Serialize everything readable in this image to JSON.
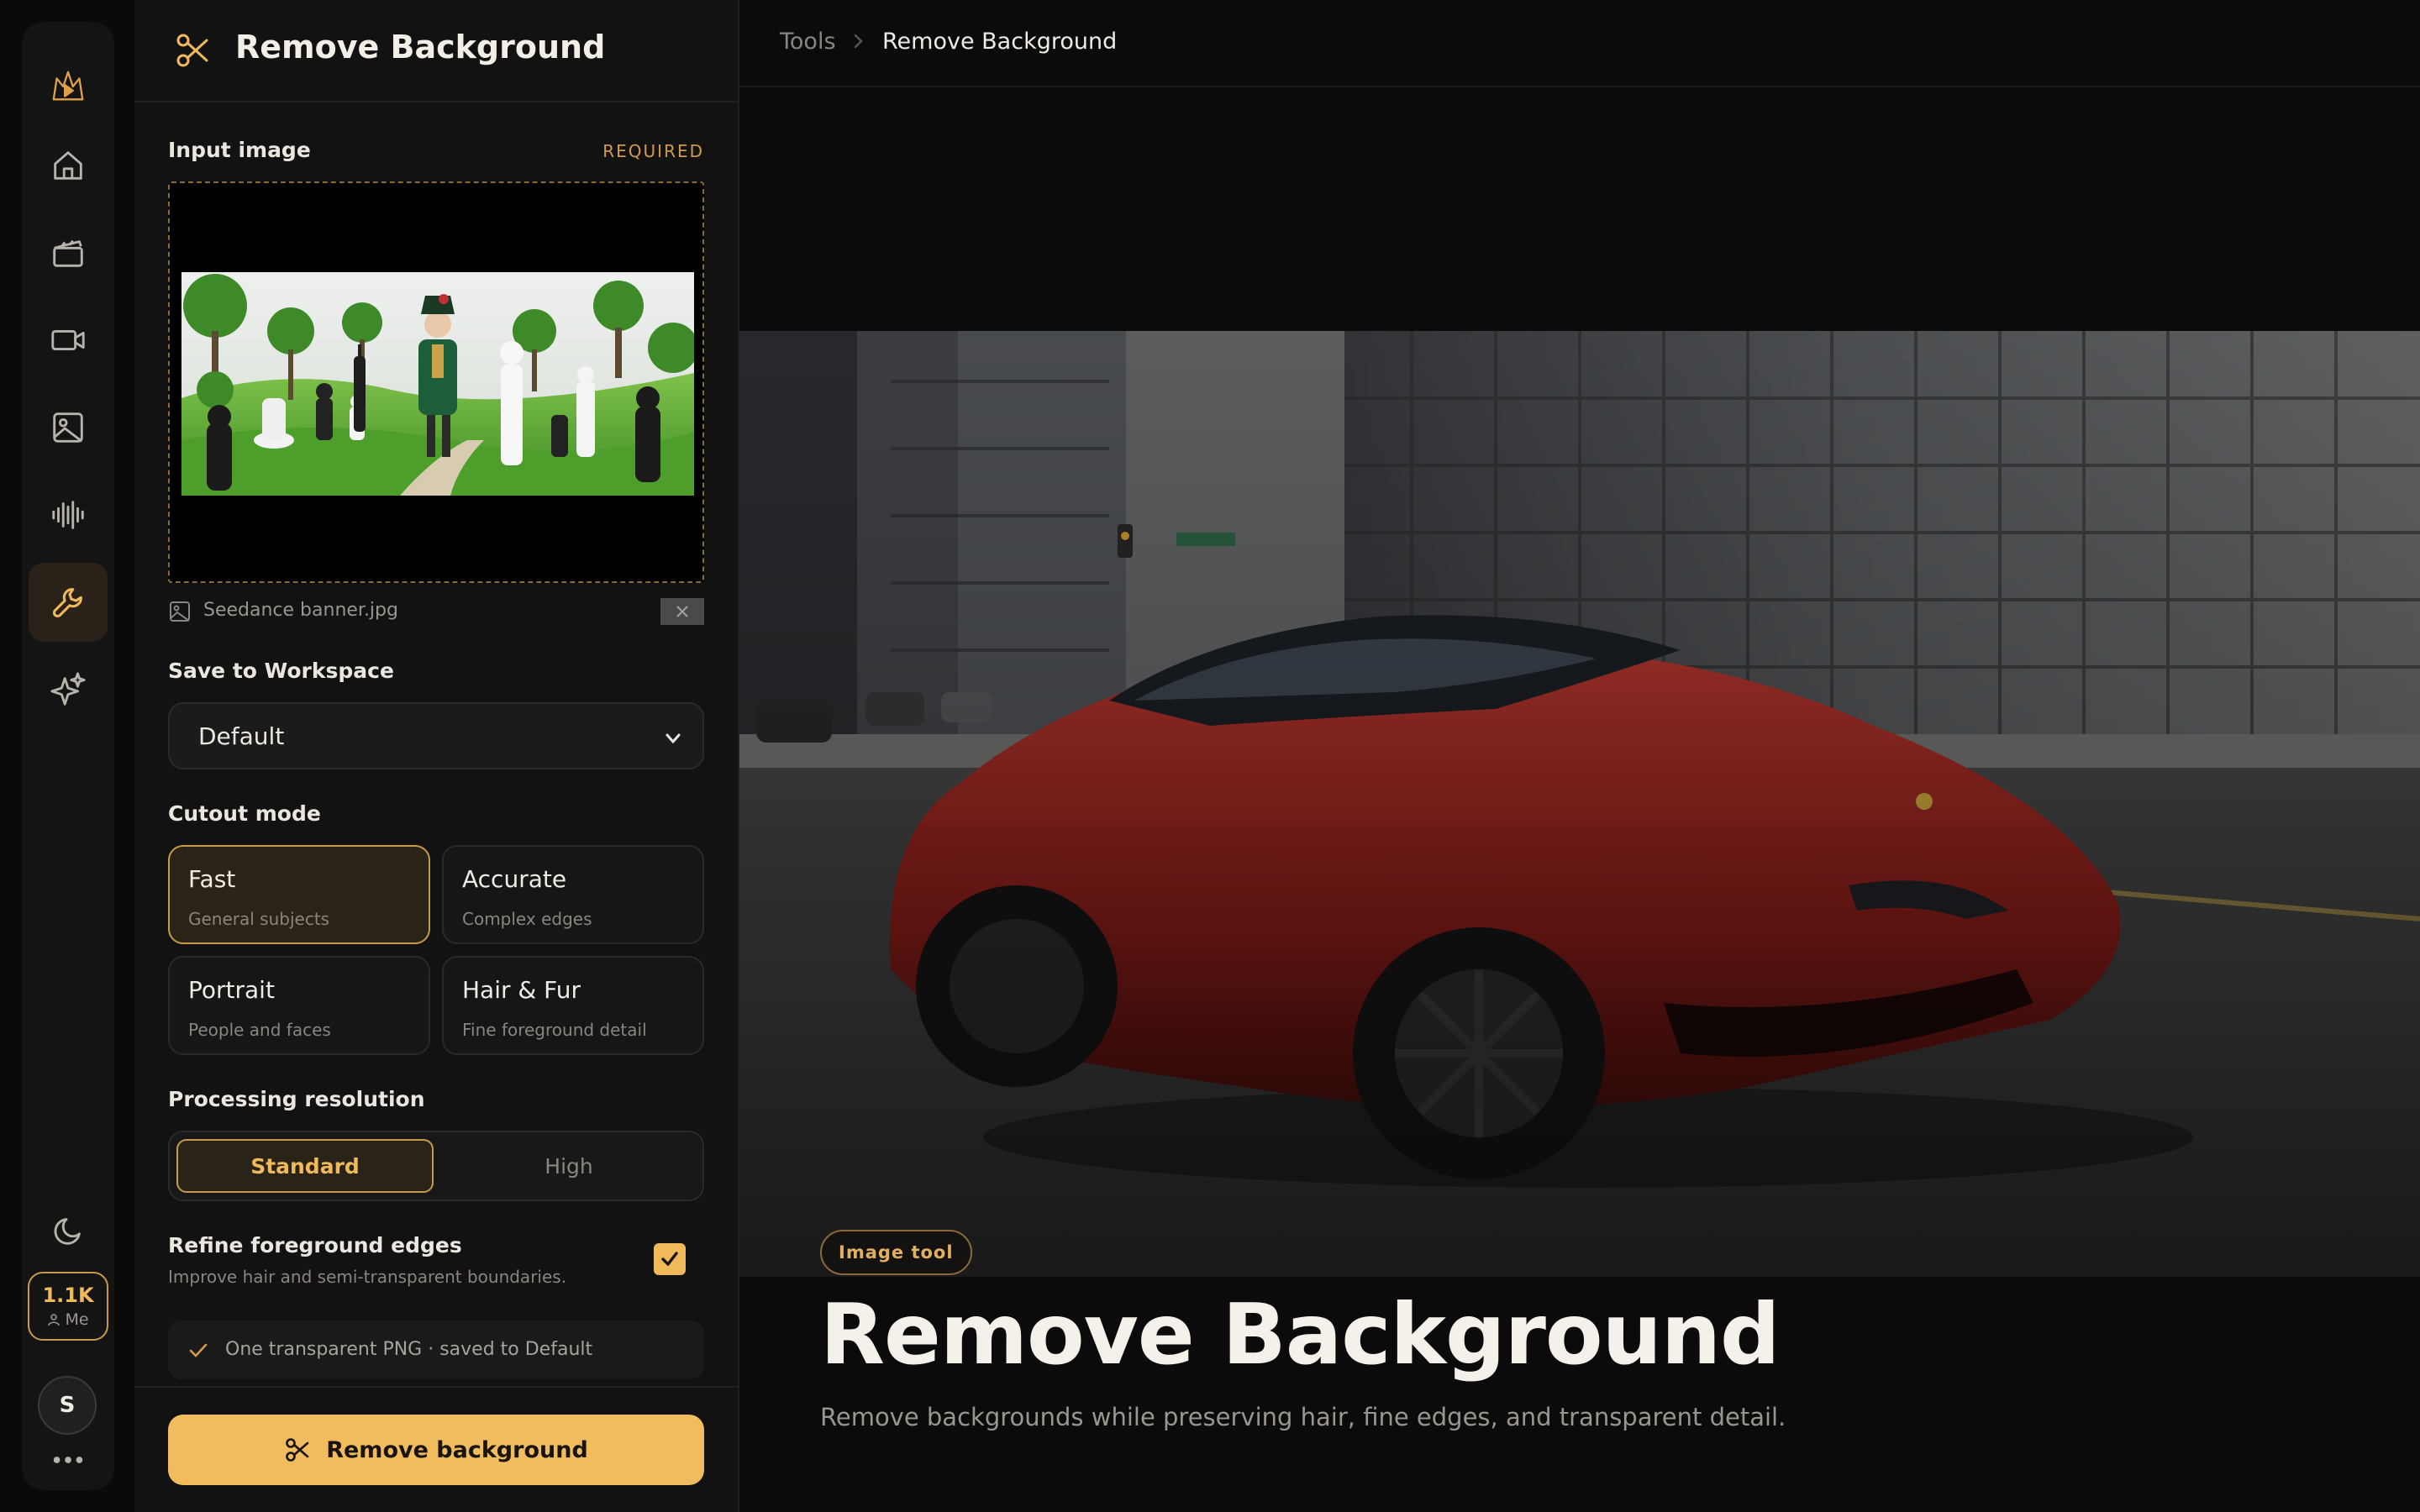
{
  "rail": {
    "items": [
      {
        "name": "logo",
        "icon": "logo-icon"
      },
      {
        "name": "home",
        "icon": "home-icon"
      },
      {
        "name": "film",
        "icon": "clapperboard-icon"
      },
      {
        "name": "video",
        "icon": "video-camera-icon"
      },
      {
        "name": "image",
        "icon": "image-icon"
      },
      {
        "name": "audio",
        "icon": "audio-wave-icon"
      },
      {
        "name": "tools",
        "icon": "wrench-icon",
        "active": true
      },
      {
        "name": "sparkle",
        "icon": "sparkle-icon"
      }
    ],
    "theme_icon": "moon-icon",
    "credits": {
      "value": "1.1K",
      "owner": "Me"
    },
    "avatar_initial": "S",
    "more_icon": "more-dots-icon"
  },
  "panel": {
    "title": "Remove Background",
    "input_label": "Input image",
    "required_label": "REQUIRED",
    "file_name": "Seedance banner.jpg",
    "workspace_label": "Save to Workspace",
    "workspace_value": "Default",
    "cutout_label": "Cutout mode",
    "modes": [
      {
        "title": "Fast",
        "subtitle": "General subjects",
        "selected": true
      },
      {
        "title": "Accurate",
        "subtitle": "Complex edges",
        "selected": false
      },
      {
        "title": "Portrait",
        "subtitle": "People and faces",
        "selected": false
      },
      {
        "title": "Hair & Fur",
        "subtitle": "Fine foreground detail",
        "selected": false
      }
    ],
    "resolution_label": "Processing resolution",
    "resolution_options": [
      "Standard",
      "High"
    ],
    "resolution_selected": "Standard",
    "refine_title": "Refine foreground edges",
    "refine_sub": "Improve hair and semi-transparent boundaries.",
    "refine_checked": true,
    "note": "One transparent PNG · saved to Default",
    "cta_label": "Remove background"
  },
  "main": {
    "breadcrumb": [
      "Tools",
      "Remove Background"
    ],
    "badge": "Image tool",
    "title": "Remove Background",
    "description": "Remove backgrounds while preserving hair, fine edges, and transparent detail."
  },
  "colors": {
    "accent": "#f1bc5e",
    "accent_border": "#c89b48",
    "background": "#0a0a0a",
    "panel": "#121212"
  }
}
